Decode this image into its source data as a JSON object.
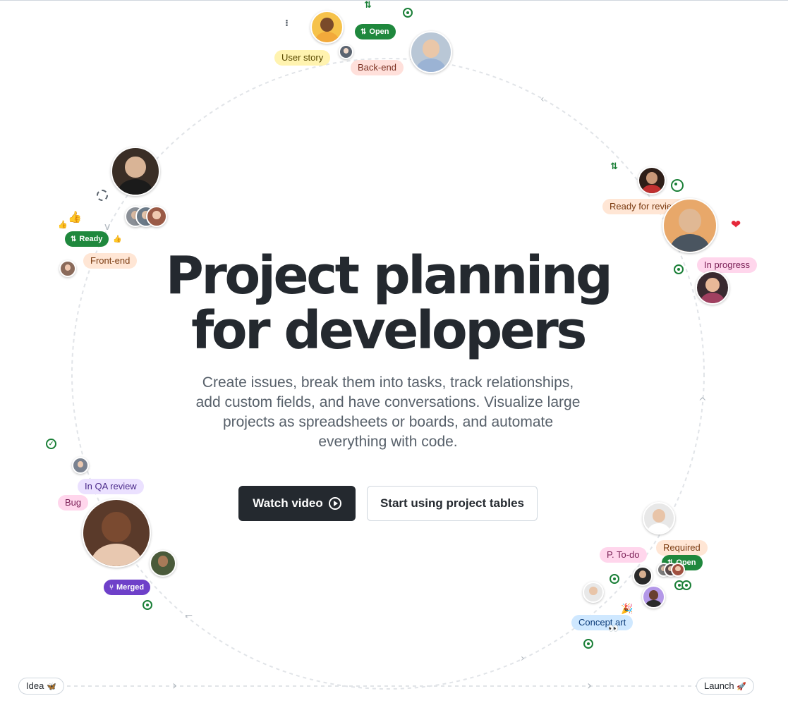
{
  "hero": {
    "title_line1": "Project planning",
    "title_line2": "for developers",
    "subtitle": "Create issues, break them into tasks, track relationships, add custom fields, and have conversations. Visualize large projects as spreadsheets or boards, and automate everything with code."
  },
  "buttons": {
    "watch_video": "Watch video",
    "start_tables": "Start using project tables"
  },
  "tags": {
    "user_story": "User story",
    "back_end": "Back-end",
    "ready_for_review": "Ready for review",
    "in_progress": "In progress",
    "front_end": "Front-end",
    "in_qa_review": "In QA  review",
    "bug": "Bug",
    "p_to_do": "P.  To-do",
    "required": "Required",
    "concept_art": "Concept art"
  },
  "pills": {
    "open_top": "Open",
    "ready": "Ready",
    "merged": "Merged",
    "open_bottom": "Open"
  },
  "milestones": {
    "idea": "Idea",
    "idea_emoji": "🦋",
    "launch": "Launch",
    "launch_emoji": "🚀"
  },
  "emojis": {
    "thumbs": "👍",
    "heart": "❤",
    "party": "🎉",
    "eyes": "👀"
  },
  "icons": {
    "pr": "⇅",
    "check": "✓",
    "chevron": "›"
  },
  "colors": {
    "accent_green": "#1f883d",
    "merged_purple": "#6e40c9",
    "primary_button": "#24292f"
  }
}
